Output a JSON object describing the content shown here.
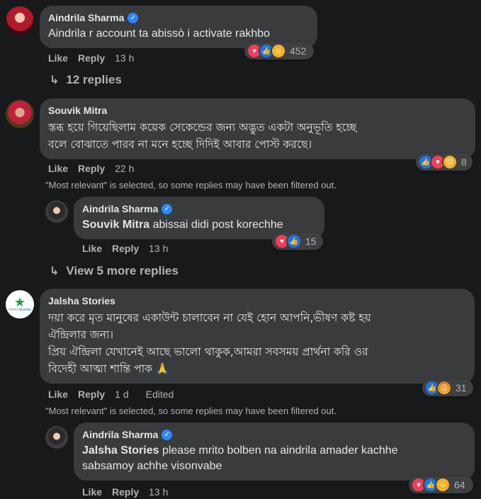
{
  "actions": {
    "like": "Like",
    "reply": "Reply"
  },
  "comments": [
    {
      "author": "Aindrila Sharma",
      "text": "Aindrila r account ta abissò i activate rakhbo",
      "time": "13 h",
      "reactions": [
        "love",
        "like",
        "care"
      ],
      "reaction_count": "452",
      "replies_link": "12 replies"
    },
    {
      "author": "Souvik Mitra",
      "text_lines": [
        "স্তব্ধ হয়ে গিয়েছিলাম কয়েক সেকেন্ডের জন্য অদ্ভুত একটা অনুভূতি হচ্ছে",
        "বলে বোঝাতে পারব না মনে হচ্ছে দিদিই আবার পোস্ট করছে।"
      ],
      "time": "22 h",
      "reactions": [
        "like",
        "love",
        "sad"
      ],
      "reaction_count": "8",
      "filter_note": "\"Most relevant\" is selected, so some replies may have been filtered out.",
      "reply": {
        "author": "Aindrila Sharma",
        "mention": "Souvik Mitra",
        "text": " abissai didi post korechhe",
        "time": "13 h",
        "reactions": [
          "love",
          "like"
        ],
        "reaction_count": "15"
      },
      "more_replies": "View 5 more replies"
    },
    {
      "author": "Jalsha Stories",
      "avatar_text": "জলসা Stories",
      "text_lines": [
        "দয়া করে মৃত মানুষের একাউন্ট চালাবেন না যেই হোন আপনি,ভীষণ কষ্ট হয়",
        "ঐন্দ্রিলার জন্য।",
        "প্রিয় ঐন্দ্রিলা যেখানেই আছে ভালো থাকুক,আমরা সবসময় প্রার্থনা করি ওর",
        "বিদেহী আত্মা শান্তি পাক 🙏"
      ],
      "time": "1 d",
      "edited": "Edited",
      "reactions": [
        "like",
        "angry"
      ],
      "reaction_count": "31",
      "filter_note": "\"Most relevant\" is selected, so some replies may have been filtered out.",
      "reply": {
        "author": "Aindrila Sharma",
        "mention": "Jalsha Stories",
        "text_line1": " please mrito bolben na aindrila amader kachhe",
        "text_line2": "sabsamoy achhe visonvabe",
        "time": "13 h",
        "reactions": [
          "love",
          "like",
          "care"
        ],
        "reaction_count": "64"
      }
    }
  ],
  "colors": {
    "bg": "#18191a",
    "bubble": "#3a3b3c",
    "text": "#e4e6eb",
    "muted": "#b0b3b8",
    "verified": "#2d88ff"
  }
}
